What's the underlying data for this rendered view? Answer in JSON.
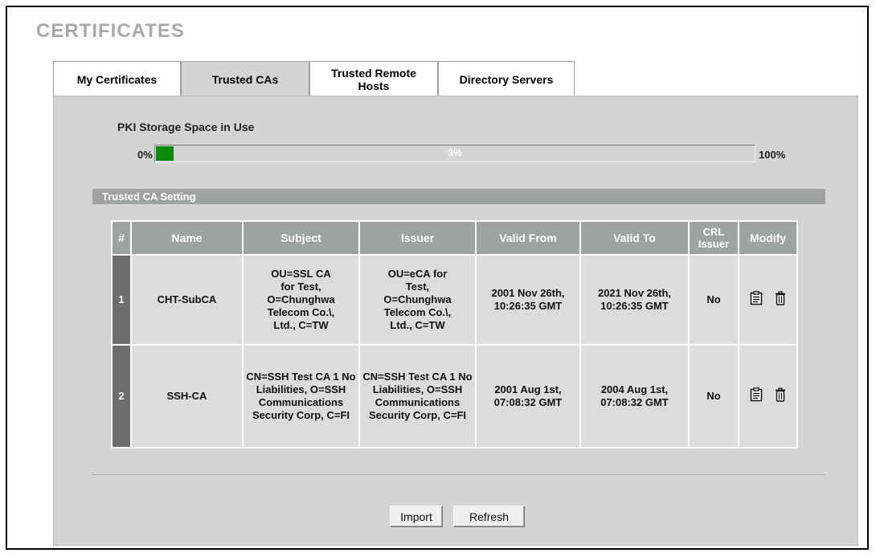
{
  "page": {
    "title": "CERTIFICATES"
  },
  "tabs": [
    {
      "label": "My Certificates",
      "active": false
    },
    {
      "label": "Trusted CAs",
      "active": true
    },
    {
      "label": "Trusted Remote Hosts",
      "active": false
    },
    {
      "label": "Directory Servers",
      "active": false
    }
  ],
  "storage": {
    "title": "PKI Storage Space in Use",
    "min_label": "0%",
    "max_label": "100%",
    "usage_label": "3%",
    "usage_fraction": 0.03,
    "fill_color": "#0a8a0a"
  },
  "section": {
    "title": "Trusted CA Setting"
  },
  "table": {
    "headers": [
      "#",
      "Name",
      "Subject",
      "Issuer",
      "Valid From",
      "Valid To",
      "CRL Issuer",
      "Modify"
    ],
    "rows": [
      {
        "num": "1",
        "name": "CHT-SubCA",
        "subject": "OU=SSL CA for Test, O=Chunghwa Telecom Co.\\, Ltd., C=TW",
        "issuer": "OU=eCA for Test, O=Chunghwa Telecom Co.\\, Ltd., C=TW",
        "valid_from": "2001 Nov 26th, 10:26:35 GMT",
        "valid_to": "2021 Nov 26th, 10:26:35 GMT",
        "crl_issuer": "No"
      },
      {
        "num": "2",
        "name": "SSH-CA",
        "subject": "CN=SSH Test CA 1 No Liabilities, O=SSH Communications Security Corp, C=FI",
        "issuer": "CN=SSH Test CA 1 No Liabilities, O=SSH Communications Security Corp, C=FI",
        "valid_from": "2001 Aug 1st, 07:08:32 GMT",
        "valid_to": "2004 Aug 1st, 07:08:32 GMT",
        "crl_issuer": "No"
      }
    ],
    "modify_icons": [
      "edit-icon",
      "delete-icon"
    ]
  },
  "buttons": {
    "import_label": "Import",
    "refresh_label": "Refresh"
  }
}
